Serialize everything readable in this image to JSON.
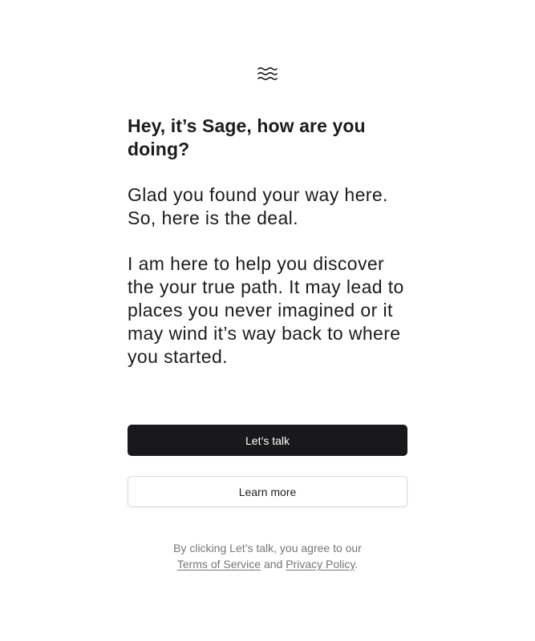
{
  "logo": {
    "icon": "waves-icon"
  },
  "headline": "Hey, it’s Sage, how are you doing?",
  "paragraphs": [
    "Glad you found your way here. So, here is the deal.",
    "I am here to help you discover the your true path. It may lead to places you never imagined or it may wind it’s way back to where you started."
  ],
  "buttons": {
    "primary_label": "Let’s talk",
    "secondary_label": "Learn more"
  },
  "legal": {
    "prefix": "By clicking Let’s talk, you agree to our",
    "terms_link": "Terms of Service",
    "conjunction": "and",
    "privacy_link": "Privacy Policy",
    "suffix": "."
  },
  "colors": {
    "primary_button_bg": "#19191b",
    "text": "#1c1c1e",
    "muted_text": "#76767b"
  }
}
